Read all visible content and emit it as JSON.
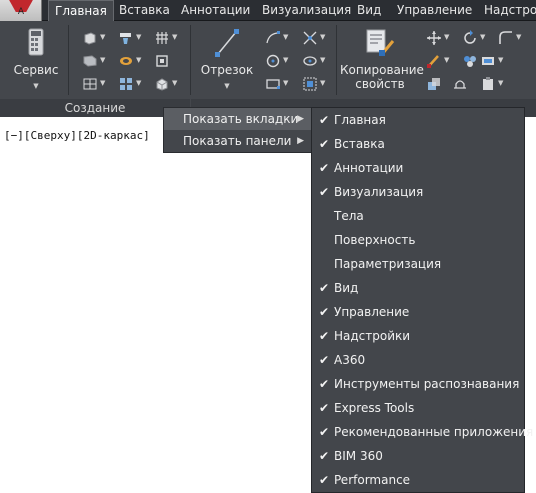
{
  "app_button": {
    "letter": "A",
    "logo_color": "#c1272d"
  },
  "tabs": [
    {
      "label": "Главная",
      "active": true
    },
    {
      "label": "Вставка"
    },
    {
      "label": "Аннотации"
    },
    {
      "label": "Визуализация"
    },
    {
      "label": "Вид"
    },
    {
      "label": "Управление"
    },
    {
      "label": "Надстрой"
    }
  ],
  "ribbon": {
    "service_label": "Сервис",
    "line_label": "Отрезок",
    "copy_props_label_1": "Копирование",
    "copy_props_label_2": "свойств",
    "panel_create_title": "Создание"
  },
  "viewport_label": "[−][Сверху][2D-каркас]",
  "context_menu": {
    "items": [
      {
        "label": "Показать вкладки",
        "highlighted": true
      },
      {
        "label": "Показать панели"
      }
    ]
  },
  "tabs_submenu": {
    "items": [
      {
        "label": "Главная",
        "checked": true
      },
      {
        "label": "Вставка",
        "checked": true
      },
      {
        "label": "Аннотации",
        "checked": true
      },
      {
        "label": "Визуализация",
        "checked": true
      },
      {
        "label": "Тела",
        "checked": false
      },
      {
        "label": "Поверхность",
        "checked": false
      },
      {
        "label": "Параметризация",
        "checked": false
      },
      {
        "label": "Вид",
        "checked": true
      },
      {
        "label": "Управление",
        "checked": true
      },
      {
        "label": "Надстройки",
        "checked": true
      },
      {
        "label": "A360",
        "checked": true
      },
      {
        "label": "Инструменты распознавания",
        "checked": true
      },
      {
        "label": "Express Tools",
        "checked": true
      },
      {
        "label": "Рекомендованные приложения",
        "checked": true
      },
      {
        "label": "BIM 360",
        "checked": true
      },
      {
        "label": "Performance",
        "checked": true
      }
    ],
    "check_glyph": "✔"
  },
  "colors": {
    "ribbon_bg": "#44474c",
    "tabbar_bg": "#2b2e33",
    "menu_bg": "#43464b",
    "menu_hover": "#5b5e63"
  }
}
